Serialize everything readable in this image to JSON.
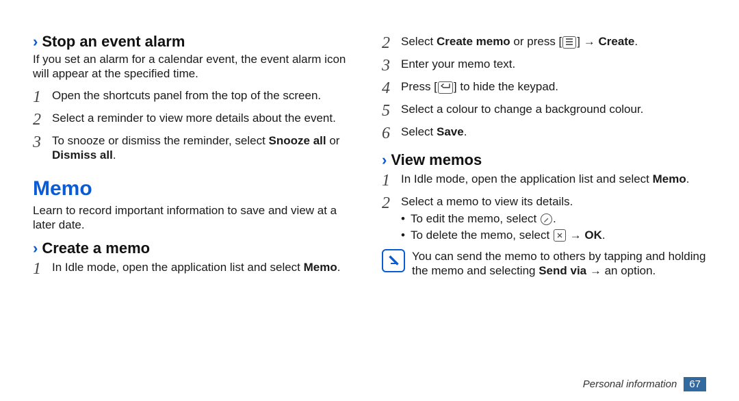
{
  "left": {
    "h_stop": "Stop an event alarm",
    "stop_intro": "If you set an alarm for a calendar event, the event alarm icon will appear at the specified time.",
    "stop_steps": [
      {
        "n": "1",
        "text": "Open the shortcuts panel from the top of the screen."
      },
      {
        "n": "2",
        "text": "Select a reminder to view more details about the event."
      },
      {
        "n": "3",
        "pre": "To snooze or dismiss the reminder, select ",
        "b1": "Snooze all",
        "mid": " or ",
        "b2": "Dismiss all",
        "post": "."
      }
    ],
    "memo_title": "Memo",
    "memo_intro": "Learn to record important information to save and view at a later date.",
    "h_create": "Create a memo",
    "create_step1_pre": "In Idle mode, open the application list and select ",
    "create_step1_bold": "Memo",
    "create_step1_post": "."
  },
  "right": {
    "s2_pre": "Select ",
    "s2_b1": "Create memo",
    "s2_mid": " or press [",
    "s2_mid2": "] → ",
    "s2_b2": "Create",
    "s2_post": ".",
    "s3": "Enter your memo text.",
    "s4_pre": "Press [",
    "s4_post": "] to hide the keypad.",
    "s5": "Select a colour to change a background colour.",
    "s6_pre": "Select ",
    "s6_b": "Save",
    "s6_post": ".",
    "h_view": "View memos",
    "v1_pre": "In Idle mode, open the application list and select ",
    "v1_b": "Memo",
    "v1_post": ".",
    "v2": "Select a memo to view its details.",
    "v2_b1": "To edit the memo, select ",
    "v2_b1_post": ".",
    "v2_b2_pre": "To delete the memo, select ",
    "v2_b2_mid": " → ",
    "v2_b2_b": "OK",
    "v2_b2_post": ".",
    "note_pre": "You can send the memo to others by tapping and holding the memo and selecting ",
    "note_b": "Send via",
    "note_mid": " → an option."
  },
  "footer": {
    "section": "Personal information",
    "page": "67"
  },
  "nums": {
    "n1": "1",
    "n2": "2",
    "n3": "3",
    "n4": "4",
    "n5": "5",
    "n6": "6"
  }
}
